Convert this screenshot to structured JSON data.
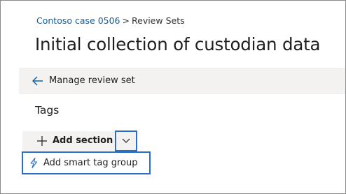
{
  "breadcrumb": {
    "case_link": "Contoso case 0506",
    "separator": ">",
    "current": "Review Sets"
  },
  "page": {
    "title": "Initial collection of custodian data"
  },
  "manage_bar": {
    "label": "Manage review set",
    "icon": "back-arrow-icon"
  },
  "tags": {
    "heading": "Tags",
    "add_section_label": "Add section",
    "add_section_icon": "plus-icon",
    "dropdown_icon": "chevron-down-icon",
    "menu": {
      "items": [
        {
          "label": "Add smart tag group",
          "icon": "lightning-bolt-icon"
        }
      ]
    }
  },
  "colors": {
    "link": "#0a5fa3",
    "accent": "#2b6fc2",
    "bar_background": "#f3f2f1",
    "text": "#201f1e"
  }
}
